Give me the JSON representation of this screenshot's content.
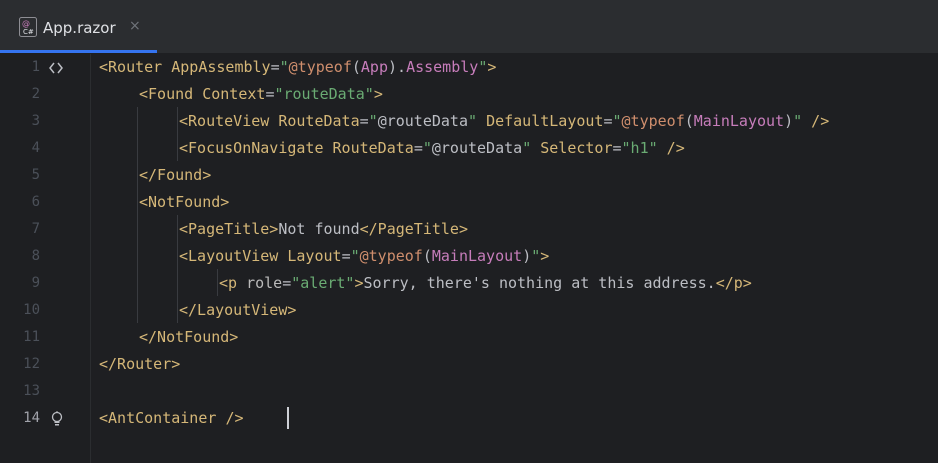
{
  "tab": {
    "label": "App.razor",
    "close": "×",
    "icon": "razor-file-icon"
  },
  "gutter": {
    "line_numbers": [
      "1",
      "2",
      "3",
      "4",
      "5",
      "6",
      "7",
      "8",
      "9",
      "10",
      "11",
      "12",
      "13",
      "14"
    ],
    "line1_icon": "structure-icon",
    "line14_icon": "lightbulb-icon"
  },
  "code": [
    [
      [
        "tag",
        "<Router "
      ],
      [
        "attr2",
        "AppAssembly"
      ],
      [
        "txt",
        "="
      ],
      [
        "str",
        "\""
      ],
      [
        "kw",
        "@typeof"
      ],
      [
        "txt",
        "("
      ],
      [
        "comp",
        "App"
      ],
      [
        "txt",
        ")."
      ],
      [
        "comp",
        "Assembly"
      ],
      [
        "str",
        "\""
      ],
      [
        "tag",
        ">"
      ]
    ],
    [
      [
        "tag",
        "<Found "
      ],
      [
        "attr2",
        "Context"
      ],
      [
        "txt",
        "="
      ],
      [
        "str",
        "\"routeData\""
      ],
      [
        "tag",
        ">"
      ]
    ],
    [
      [
        "tag",
        "<RouteView "
      ],
      [
        "attr2",
        "RouteData"
      ],
      [
        "txt",
        "="
      ],
      [
        "str",
        "\""
      ],
      [
        "txt",
        "@routeData"
      ],
      [
        "str",
        "\""
      ],
      [
        "txt",
        " "
      ],
      [
        "attr2",
        "DefaultLayout"
      ],
      [
        "txt",
        "="
      ],
      [
        "str",
        "\""
      ],
      [
        "kw",
        "@typeof"
      ],
      [
        "txt",
        "("
      ],
      [
        "comp",
        "MainLayout"
      ],
      [
        "txt",
        ")"
      ],
      [
        "str",
        "\""
      ],
      [
        "tag",
        " />"
      ]
    ],
    [
      [
        "tag",
        "<FocusOnNavigate "
      ],
      [
        "attr2",
        "RouteData"
      ],
      [
        "txt",
        "="
      ],
      [
        "str",
        "\""
      ],
      [
        "txt",
        "@routeData"
      ],
      [
        "str",
        "\""
      ],
      [
        "txt",
        " "
      ],
      [
        "attr2",
        "Selector"
      ],
      [
        "txt",
        "="
      ],
      [
        "str",
        "\"h1\""
      ],
      [
        "tag",
        " />"
      ]
    ],
    [
      [
        "tag",
        "</Found>"
      ]
    ],
    [
      [
        "tag",
        "<NotFound>"
      ]
    ],
    [
      [
        "tag",
        "<PageTitle>"
      ],
      [
        "txt",
        "Not found"
      ],
      [
        "tag",
        "</PageTitle>"
      ]
    ],
    [
      [
        "tag",
        "<LayoutView "
      ],
      [
        "attr2",
        "Layout"
      ],
      [
        "txt",
        "="
      ],
      [
        "str",
        "\""
      ],
      [
        "kw",
        "@typeof"
      ],
      [
        "txt",
        "("
      ],
      [
        "comp",
        "MainLayout"
      ],
      [
        "txt",
        ")"
      ],
      [
        "str",
        "\""
      ],
      [
        "tag",
        ">"
      ]
    ],
    [
      [
        "tag",
        "<p "
      ],
      [
        "attr",
        "role"
      ],
      [
        "txt",
        "="
      ],
      [
        "str",
        "\"alert\""
      ],
      [
        "tag",
        ">"
      ],
      [
        "txt",
        "Sorry, there's nothing at this address."
      ],
      [
        "tag",
        "</p>"
      ]
    ],
    [
      [
        "tag",
        "</LayoutView>"
      ]
    ],
    [
      [
        "tag",
        "</NotFound>"
      ]
    ],
    [
      [
        "tag",
        "</Router>"
      ]
    ],
    [],
    [
      [
        "tag",
        "<AntContainer "
      ],
      [
        "tag",
        "/>"
      ]
    ]
  ],
  "colors": {
    "tag": "#d5b778",
    "string": "#6aab73",
    "keyword": "#cf8e6d",
    "type": "#c77dbb",
    "accent": "#3574f0"
  }
}
